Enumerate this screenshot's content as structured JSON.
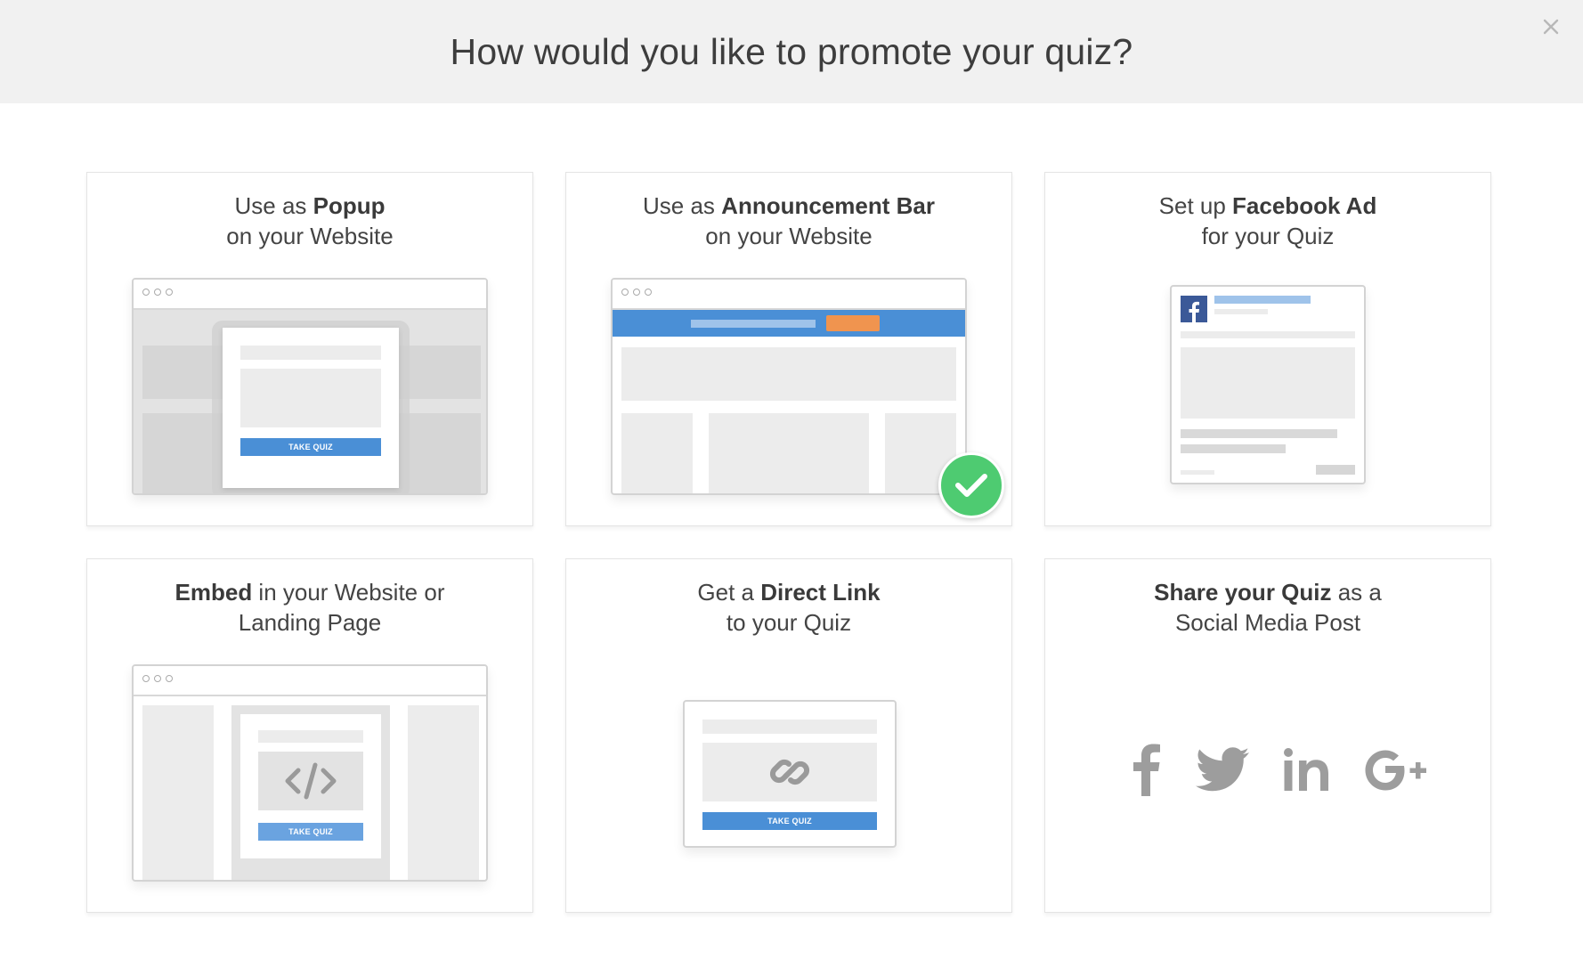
{
  "header": {
    "title": "How would you like to promote your quiz?",
    "close_icon": "close-icon"
  },
  "cards": [
    {
      "pre": "Use as ",
      "bold": "Popup",
      "post": "",
      "line2": "on your Website",
      "button": "TAKE QUIZ"
    },
    {
      "pre": "Use as ",
      "bold": "Announcement Bar",
      "post": "",
      "line2": "on your Website",
      "selected": true
    },
    {
      "pre": "Set up ",
      "bold": "Facebook Ad",
      "post": "",
      "line2": "for your Quiz"
    },
    {
      "pre": "",
      "bold": "Embed",
      "post": " in your Website or",
      "line2": "Landing Page",
      "button": "TAKE QUIZ"
    },
    {
      "pre": "Get a ",
      "bold": "Direct Link",
      "post": "",
      "line2": "to your Quiz",
      "button": "TAKE QUIZ"
    },
    {
      "pre": "",
      "bold": "Share your Quiz",
      "post": " as a",
      "line2": "Social Media Post",
      "icons": [
        "facebook-icon",
        "twitter-icon",
        "linkedin-icon",
        "google-plus-icon"
      ]
    }
  ],
  "colors": {
    "accent_blue": "#4a8fd6",
    "announcement_button": "#f0944f",
    "selected_check": "#4ecb71",
    "facebook_blue": "#3b5998"
  }
}
